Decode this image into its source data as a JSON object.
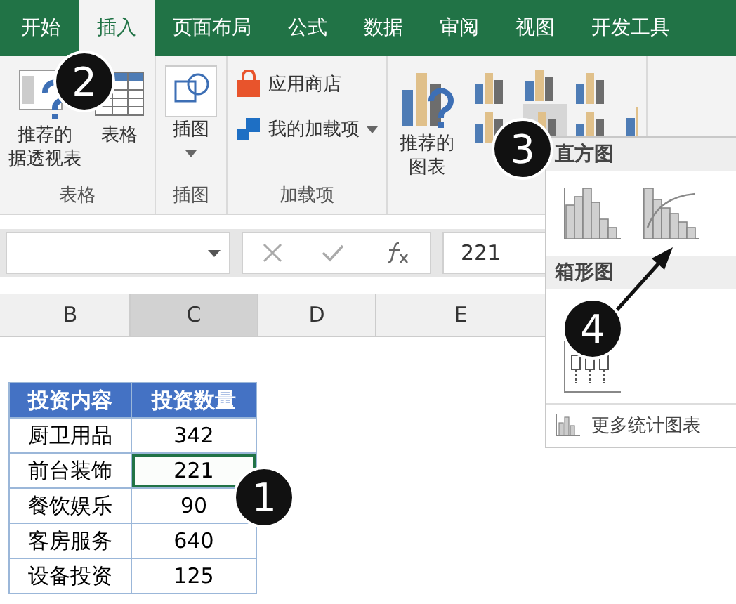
{
  "tabs": [
    {
      "label": "开始",
      "selected": false
    },
    {
      "label": "插入",
      "selected": true
    },
    {
      "label": "页面布局",
      "selected": false
    },
    {
      "label": "公式",
      "selected": false
    },
    {
      "label": "数据",
      "selected": false
    },
    {
      "label": "审阅",
      "selected": false
    },
    {
      "label": "视图",
      "selected": false
    },
    {
      "label": "开发工具",
      "selected": false
    }
  ],
  "ribbon": {
    "groups": [
      {
        "label": "表格",
        "buttons": [
          {
            "kind": "pivot",
            "lines": [
              "推荐的",
              "据透视表"
            ]
          },
          {
            "kind": "table",
            "lines": [
              "表格"
            ]
          }
        ]
      },
      {
        "label": "插图",
        "buttons": [
          {
            "kind": "illustration",
            "lines": [
              "插图"
            ]
          }
        ]
      },
      {
        "label": "加载项",
        "buttons": [
          {
            "kind": "store",
            "lines": [
              "应用商店"
            ]
          },
          {
            "kind": "addins",
            "lines": [
              "我的加载项"
            ]
          }
        ]
      },
      {
        "buttons": [
          {
            "kind": "charts",
            "lines": [
              "推荐的",
              "图表"
            ]
          }
        ]
      }
    ]
  },
  "formula_bar": {
    "value": "221"
  },
  "columns": [
    {
      "label": "B",
      "selected": false
    },
    {
      "label": "C",
      "selected": true
    },
    {
      "label": "D",
      "selected": false
    },
    {
      "label": "E",
      "selected": false
    }
  ],
  "table": {
    "columns": [
      "投资内容",
      "投资数量"
    ],
    "rows": [
      {
        "cells": [
          "厨卫用品",
          "342"
        ],
        "selected": false
      },
      {
        "cells": [
          "前台装饰",
          "221"
        ],
        "selected": true
      },
      {
        "cells": [
          "餐饮娱乐",
          "90"
        ],
        "selected": false
      },
      {
        "cells": [
          "客房服务",
          "640"
        ],
        "selected": false
      },
      {
        "cells": [
          "设备投资",
          "125"
        ],
        "selected": false
      }
    ]
  },
  "chart_menu": {
    "sections": [
      {
        "kind": "histogram",
        "title": "直方图"
      },
      {
        "kind": "boxplot",
        "title": "箱形图"
      }
    ],
    "footer": "更多统计图表"
  },
  "callouts": [
    "1",
    "2",
    "3",
    "4"
  ]
}
